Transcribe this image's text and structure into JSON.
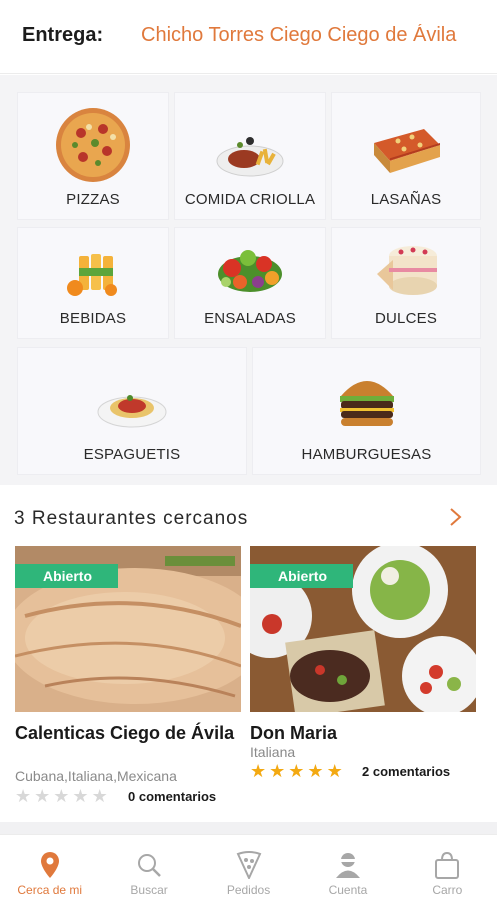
{
  "header": {
    "delivery_label": "Entrega:",
    "address": "Chicho Torres Ciego Ciego de Ávila"
  },
  "categories": [
    {
      "label": "PIZZAS",
      "icon": "pizza-icon"
    },
    {
      "label": "COMIDA CRIOLLA",
      "icon": "creole-food-icon"
    },
    {
      "label": "LASAÑAS",
      "icon": "lasagna-icon"
    },
    {
      "label": "BEBIDAS",
      "icon": "drinks-icon"
    },
    {
      "label": "ENSALADAS",
      "icon": "salad-icon"
    },
    {
      "label": "DULCES",
      "icon": "cake-icon"
    },
    {
      "label": "ESPAGUETIS",
      "icon": "spaghetti-icon"
    },
    {
      "label": "HAMBURGUESAS",
      "icon": "burger-icon"
    }
  ],
  "nearby": {
    "title": "3 Restaurantes cercanos"
  },
  "restaurants": [
    {
      "status": "Abierto",
      "name": "Calenticas Ciego de Ávila",
      "cuisine": "Cubana,Italiana,Mexicana",
      "rating": 0,
      "comments": "0 comentarios"
    },
    {
      "status": "Abierto",
      "name": "Don Maria",
      "cuisine": "Italiana",
      "rating": 5,
      "comments": "2 comentarios"
    }
  ],
  "colors": {
    "accent": "#e0793c",
    "open_badge": "#2fb67a",
    "star_on": "#f3a912",
    "star_off": "#d8d8d8"
  },
  "nav": [
    {
      "label": "Cerca de mi",
      "icon": "location-pin-icon",
      "active": true
    },
    {
      "label": "Buscar",
      "icon": "search-icon",
      "active": false
    },
    {
      "label": "Pedidos",
      "icon": "pizza-slice-icon",
      "active": false
    },
    {
      "label": "Cuenta",
      "icon": "user-icon",
      "active": false
    },
    {
      "label": "Carro",
      "icon": "shopping-bag-icon",
      "active": false
    }
  ]
}
